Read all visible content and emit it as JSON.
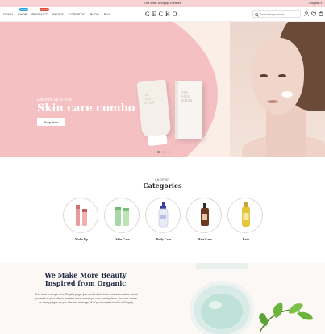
{
  "announcement": {
    "text": "The Best Shopify Themes",
    "language": "English"
  },
  "header": {
    "nav": [
      {
        "label": "DEMO",
        "badge": ""
      },
      {
        "label": "SHOP",
        "badge": "NEW",
        "badge_color": "#2fa3d6"
      },
      {
        "label": "PRODUCT",
        "badge": "SALE",
        "badge_color": "#e04e3a"
      },
      {
        "label": "PAGES",
        "badge": ""
      },
      {
        "label": "COSMETIC",
        "badge": ""
      },
      {
        "label": "BLOG",
        "badge": ""
      },
      {
        "label": "BUY",
        "badge": ""
      }
    ],
    "logo": "GECKO",
    "search_placeholder": "Search for products"
  },
  "hero": {
    "kicker": "Discount up to 20%",
    "headline": "Skin care combo",
    "button": "Shop Now",
    "tube_text": [
      "THE",
      "FACE",
      "SCRUB"
    ],
    "box_text": [
      "THE",
      "FACE",
      "SCRUB"
    ],
    "slides": 3,
    "active_slide": 1
  },
  "categories": {
    "kicker": "SHOP BY",
    "title": "Categories",
    "items": [
      {
        "label": "Make Up",
        "icon": "lip-gloss-icon"
      },
      {
        "label": "Skin Care",
        "icon": "skin-care-tubes-icon"
      },
      {
        "label": "Body Care",
        "icon": "lotion-bottle-icon"
      },
      {
        "label": "Hair Care",
        "icon": "hair-oil-bottle-icon"
      },
      {
        "label": "Bath",
        "icon": "bath-oil-bottle-icon"
      }
    ]
  },
  "about": {
    "title_line1": "We Make More Beauty",
    "title_line2": "Inspired from Organic",
    "text": "This is an example of a Shopify page, you could add this to your information about yourself or your site so readers know where you are coming from. You can create as many pages as you like and manage all of your content inside of Shopify."
  },
  "colors": {
    "accent_pink": "#f4c0c2",
    "cream": "#fbeee6",
    "badge_new": "#2fa3d6",
    "badge_sale": "#e04e3a"
  }
}
